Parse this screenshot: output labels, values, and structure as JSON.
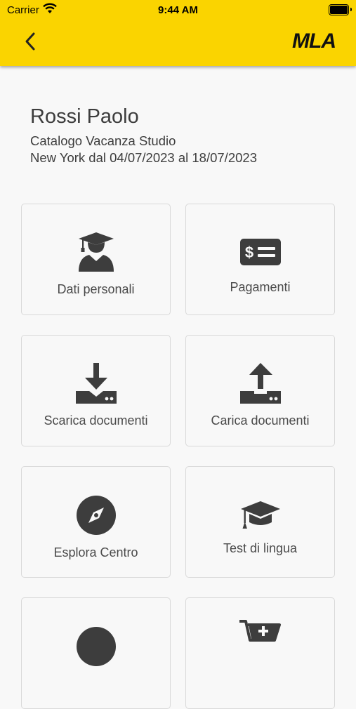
{
  "status_bar": {
    "carrier": "Carrier",
    "time": "9:44 AM"
  },
  "nav": {
    "back_icon": "chevron-left-icon",
    "logo_text": "MLA"
  },
  "header": {
    "name": "Rossi Paolo",
    "program": "Catalogo Vacanza Studio",
    "dates": "New York dal 04/07/2023 al 18/07/2023"
  },
  "tiles": [
    {
      "label": "Dati personali",
      "icon": "student-icon"
    },
    {
      "label": "Pagamenti",
      "icon": "money-bill-icon"
    },
    {
      "label": "Scarica documenti",
      "icon": "download-icon"
    },
    {
      "label": "Carica documenti",
      "icon": "upload-icon"
    },
    {
      "label": "Esplora Centro",
      "icon": "compass-icon"
    },
    {
      "label": "Test di lingua",
      "icon": "graduation-cap-icon"
    }
  ],
  "colors": {
    "header": "#fad400",
    "icon": "#3d3d3d",
    "background": "#f8f8f8"
  }
}
